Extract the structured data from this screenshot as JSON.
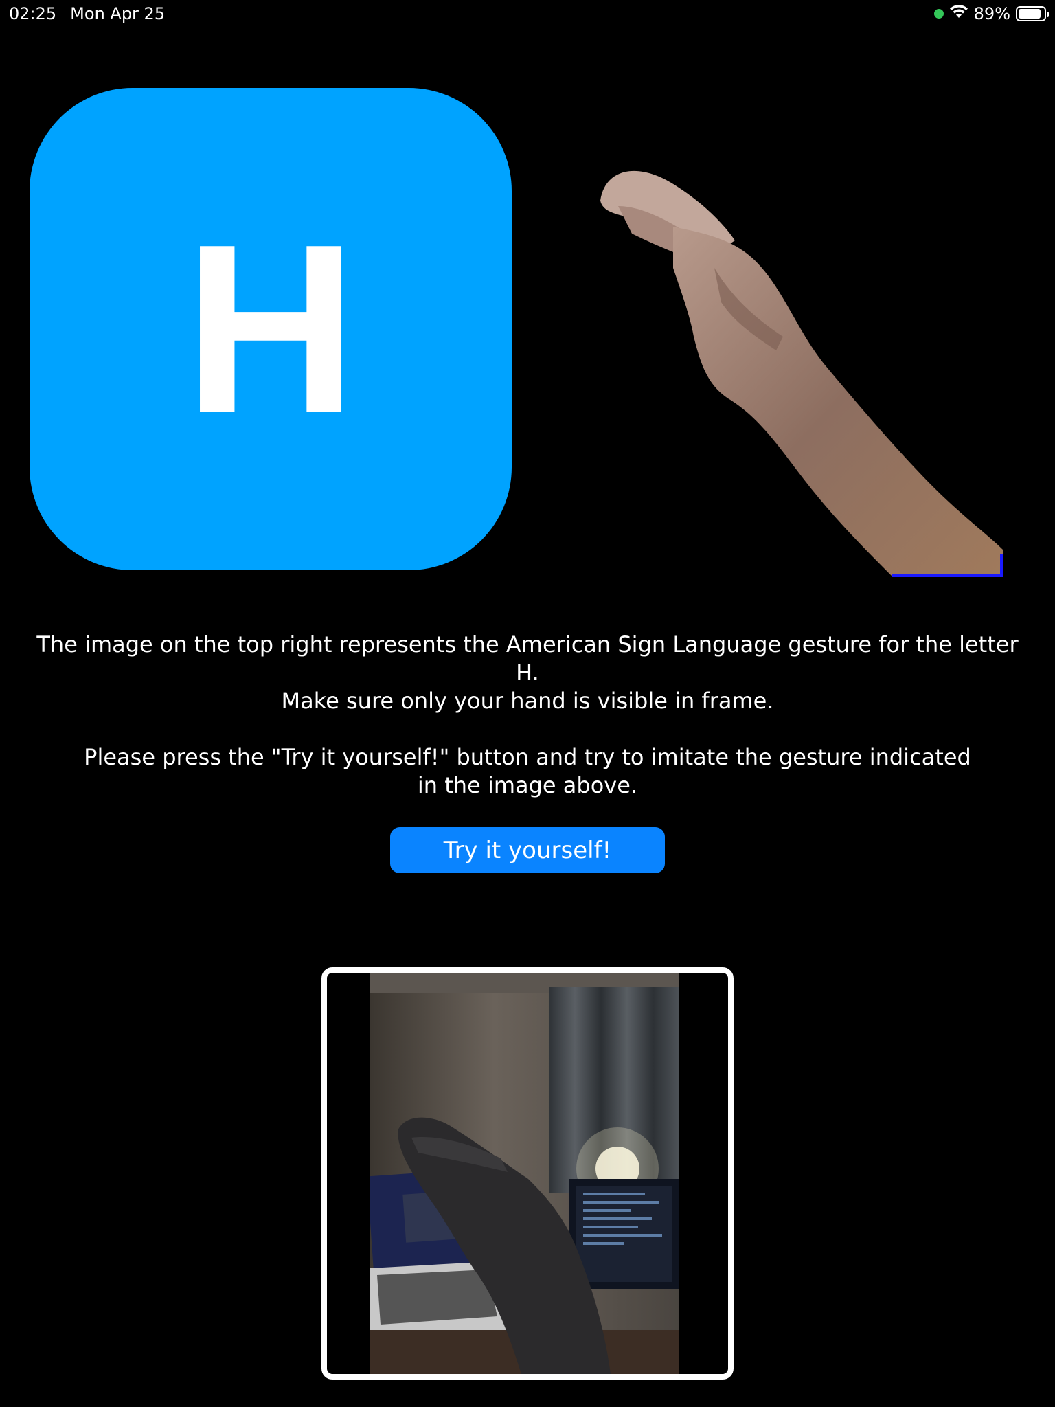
{
  "status_bar": {
    "time": "02:25",
    "date": "Mon Apr 25",
    "battery": "89%",
    "battery_level": 0.89,
    "camera_indicator_color": "#34c759"
  },
  "letter_card": {
    "letter": "H",
    "color": "#00a3ff"
  },
  "gesture_image": {
    "icon": "hand-gesture-image"
  },
  "instructions": {
    "line1": "The image on the top right represents the American Sign Language gesture for the letter H.",
    "line2": "Make sure only your hand is visible in frame.",
    "line3": "Please press the \"Try it yourself!\" button and try to imitate the gesture indicated in the image above."
  },
  "try_button": {
    "label": "Try it yourself!",
    "color": "#0a84ff"
  },
  "camera_preview": {
    "icon": "camera-feed"
  }
}
